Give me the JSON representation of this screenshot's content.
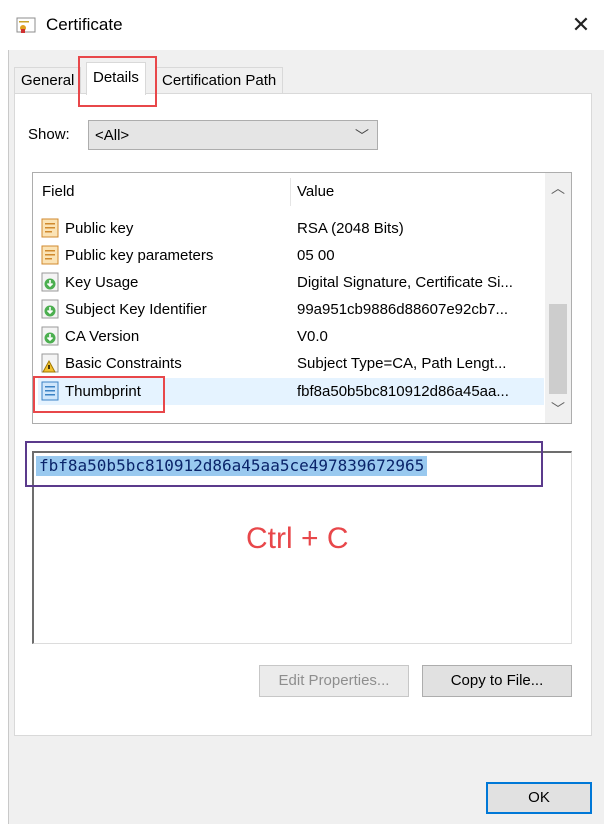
{
  "window": {
    "title": "Certificate",
    "close_glyph": "✕"
  },
  "tabs": [
    {
      "label": "General",
      "active": false
    },
    {
      "label": "Details",
      "active": true
    },
    {
      "label": "Certification Path",
      "active": false
    }
  ],
  "show": {
    "label": "Show:",
    "value": "<All>"
  },
  "list": {
    "col_field": "Field",
    "col_value": "Value",
    "rows": [
      {
        "field": "Public key",
        "value": "RSA (2048 Bits)",
        "icon": "document-icon"
      },
      {
        "field": "Public key parameters",
        "value": "05 00",
        "icon": "document-icon"
      },
      {
        "field": "Key Usage",
        "value": "Digital Signature, Certificate Si...",
        "icon": "extension-icon"
      },
      {
        "field": "Subject Key Identifier",
        "value": "99a951cb9886d88607e92cb7...",
        "icon": "extension-icon"
      },
      {
        "field": "CA Version",
        "value": "V0.0",
        "icon": "extension-icon"
      },
      {
        "field": "Basic Constraints",
        "value": "Subject Type=CA, Path Lengt...",
        "icon": "warning-extension-icon"
      },
      {
        "field": "Thumbprint",
        "value": "fbf8a50b5bc810912d86a45aa...",
        "icon": "thumbprint-icon",
        "selected": true
      }
    ]
  },
  "value_box": {
    "text": "fbf8a50b5bc810912d86a45aa5ce497839672965"
  },
  "annotation": {
    "text": "Ctrl + C",
    "color": "#e8474a"
  },
  "buttons": {
    "edit_properties": "Edit Properties...",
    "copy_to_file": "Copy to File...",
    "ok": "OK"
  },
  "colors": {
    "highlight_red": "#e8474a",
    "highlight_purple": "#5b3a8c",
    "selection": "#99c9ef"
  }
}
